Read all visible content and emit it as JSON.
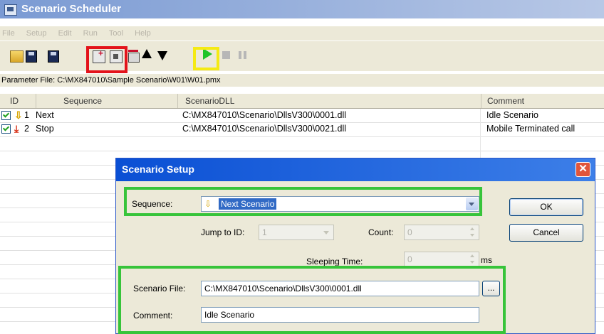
{
  "window": {
    "title": "Scenario Scheduler"
  },
  "menu": [
    "File",
    "Setup",
    "Edit",
    "Run",
    "Tool",
    "Help"
  ],
  "parameter_file": "Parameter File: C:\\MX847010\\Sample Scenario\\W01\\W01.pmx",
  "grid": {
    "headers": {
      "id": "ID",
      "sequence": "Sequence",
      "dll": "ScenarioDLL",
      "comment": "Comment"
    },
    "rows": [
      {
        "id": "1",
        "sequence": "Next",
        "dll": "C:\\MX847010\\Scenario\\DllsV300\\0001.dll",
        "comment": "Idle Scenario"
      },
      {
        "id": "2",
        "sequence": "Stop",
        "dll": "C:\\MX847010\\Scenario\\DllsV300\\0021.dll",
        "comment": "Mobile Terminated call"
      }
    ]
  },
  "dialog": {
    "title": "Scenario Setup",
    "sequence_label": "Sequence:",
    "sequence_value": "Next Scenario",
    "jump_label": "Jump to ID:",
    "jump_value": "1",
    "count_label": "Count:",
    "count_value": "0",
    "sleep_label": "Sleeping Time:",
    "sleep_value": "0",
    "sleep_unit": "ms",
    "file_label": "Scenario File:",
    "file_value": "C:\\MX847010\\Scenario\\DllsV300\\0001.dll",
    "browse_label": "...",
    "comment_label": "Comment:",
    "comment_value": "Idle Scenario",
    "ok_label": "OK",
    "cancel_label": "Cancel",
    "close_label": "✕"
  }
}
